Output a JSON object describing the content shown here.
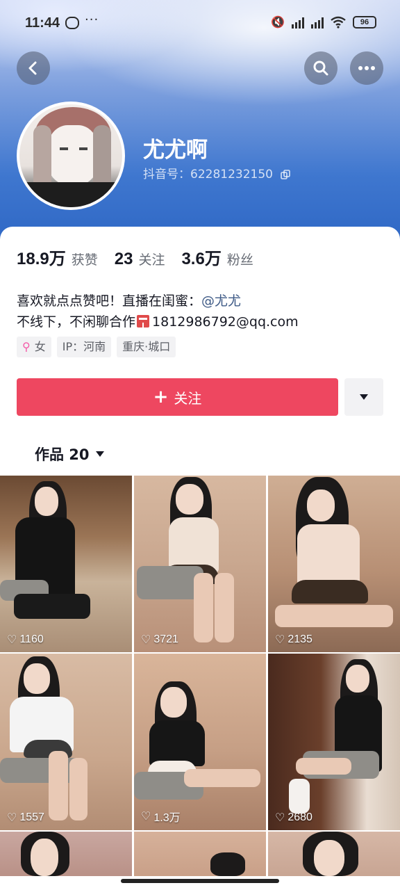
{
  "status_bar": {
    "time": "11:44",
    "battery": "96"
  },
  "profile": {
    "nickname": "尤尤啊",
    "douyin_id": "抖音号：62281232150",
    "stats": [
      {
        "value": "18.9万",
        "label": "获赞"
      },
      {
        "value": "23",
        "label": "关注"
      },
      {
        "value": "3.6万",
        "label": "粉丝"
      }
    ],
    "bio_line1_prefix": "喜欢就点点赞吧！直播在闺蜜：",
    "bio_mention": "@尤尤",
    "bio_line2_prefix": "不线下，不闲聊合作",
    "bio_email": "1812986792@qq.com",
    "tags": {
      "gender": "女",
      "ip": "IP：河南",
      "location": "重庆·城口"
    }
  },
  "actions": {
    "follow_label": "关注"
  },
  "works": {
    "tab_label": "作品 20"
  },
  "videos": [
    {
      "likes": "1160"
    },
    {
      "likes": "3721"
    },
    {
      "likes": "2135"
    },
    {
      "likes": "1557"
    },
    {
      "likes": "1.3万"
    },
    {
      "likes": "2680"
    }
  ],
  "colors": {
    "follow_button": "#ee4760",
    "header_gradient_top": "#c9d5f3",
    "header_gradient_bottom": "#2d66c4",
    "mention": "#3e5a86"
  }
}
